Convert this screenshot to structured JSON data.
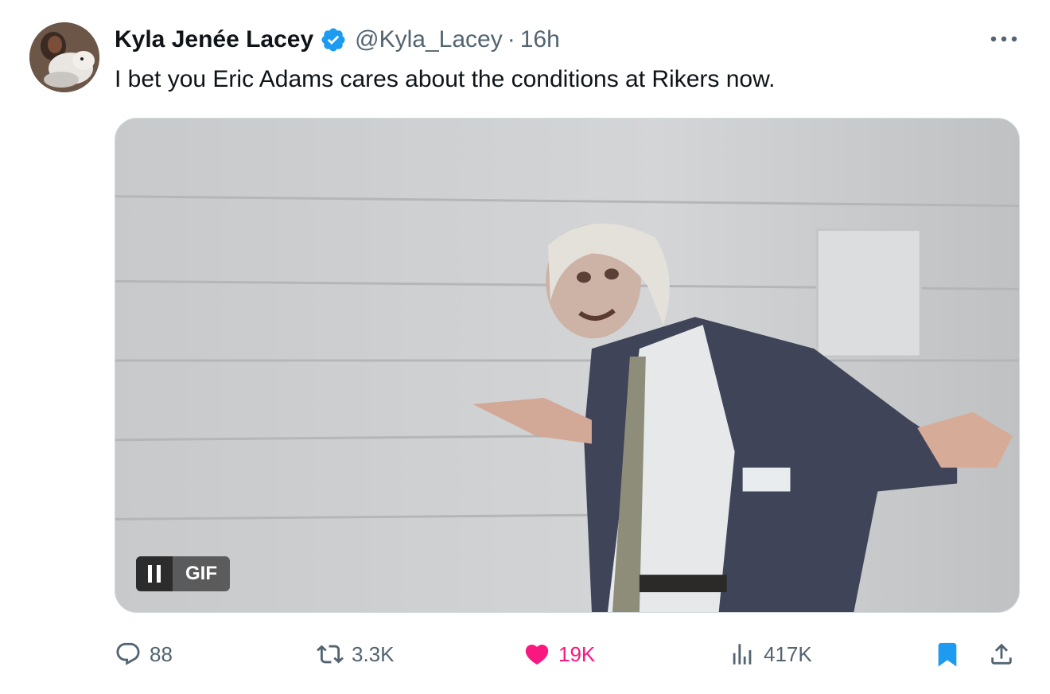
{
  "tweet": {
    "author_name": "Kyla Jenée Lacey",
    "handle": "@Kyla_Lacey",
    "separator": "·",
    "time": "16h",
    "text": "I bet you Eric Adams cares about the conditions at Rikers now."
  },
  "media": {
    "type": "gif",
    "badge_label": "GIF",
    "state": "playing"
  },
  "actions": {
    "replies": "88",
    "reposts": "3.3K",
    "likes": "19K",
    "views": "417K"
  },
  "colors": {
    "verified": "#1d9bf0",
    "like": "#f91880",
    "bookmark": "#1d9bf0",
    "muted": "#536471",
    "text": "#0f1419"
  },
  "icons": {
    "verified": "verified-badge-icon",
    "more": "more-dots-icon",
    "reply": "reply-icon",
    "retweet": "retweet-icon",
    "like": "heart-icon",
    "views": "views-chart-icon",
    "bookmark": "bookmark-icon",
    "share": "share-icon"
  }
}
